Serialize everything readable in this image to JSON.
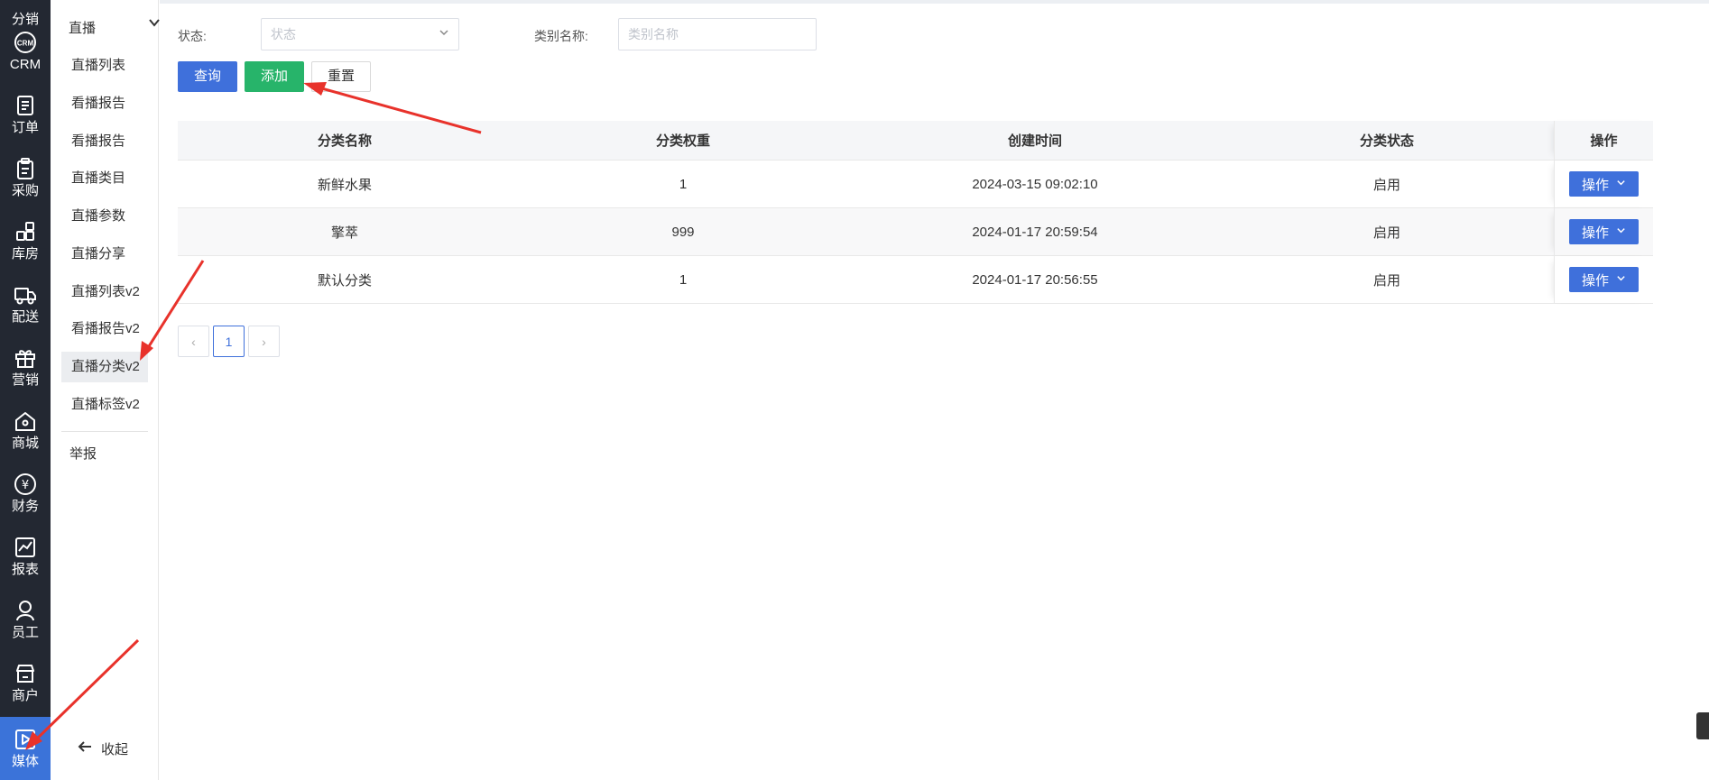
{
  "icon_nav": [
    {
      "label": "分销",
      "icon": "share-icon"
    },
    {
      "label": "CRM",
      "icon": "crm-icon"
    },
    {
      "label": "订单",
      "icon": "order-icon"
    },
    {
      "label": "采购",
      "icon": "clipboard-icon"
    },
    {
      "label": "库房",
      "icon": "warehouse-icon"
    },
    {
      "label": "配送",
      "icon": "truck-icon"
    },
    {
      "label": "营销",
      "icon": "gift-icon"
    },
    {
      "label": "商城",
      "icon": "home-icon"
    },
    {
      "label": "财务",
      "icon": "yen-icon"
    },
    {
      "label": "报表",
      "icon": "chart-icon"
    },
    {
      "label": "员工",
      "icon": "user-icon"
    },
    {
      "label": "商户",
      "icon": "shop-icon"
    },
    {
      "label": "媒体",
      "icon": "play-icon",
      "active": true
    }
  ],
  "sub_menu": {
    "group_title": "直播",
    "items": [
      "直播列表",
      "看播报告",
      "看播报告",
      "直播类目",
      "直播参数",
      "直播分享",
      "直播列表v2",
      "看播报告v2",
      "直播分类v2",
      "直播标签v2"
    ],
    "active_item": "直播分类v2",
    "other": "举报",
    "collapse_label": "收起"
  },
  "filter": {
    "status_label": "状态:",
    "status_placeholder": "状态",
    "category_label": "类别名称:",
    "category_placeholder": "类别名称"
  },
  "buttons": {
    "query": "查询",
    "add": "添加",
    "reset": "重置"
  },
  "table": {
    "headers": [
      "分类名称",
      "分类权重",
      "创建时间",
      "分类状态",
      "操作"
    ],
    "rows": [
      {
        "name": "新鲜水果",
        "weight": "1",
        "created": "2024-03-15 09:02:10",
        "status": "启用",
        "action": "操作"
      },
      {
        "name": "擎萃",
        "weight": "999",
        "created": "2024-01-17 20:59:54",
        "status": "启用",
        "action": "操作"
      },
      {
        "name": "默认分类",
        "weight": "1",
        "created": "2024-01-17 20:56:55",
        "status": "启用",
        "action": "操作"
      }
    ]
  },
  "pagination": {
    "prev": "‹",
    "current": "1",
    "next": "›"
  },
  "colors": {
    "nav_bg": "#232832",
    "nav_active": "#3b73d9",
    "primary": "#3f70db",
    "success": "#27b46a",
    "annotation": "#e8322b"
  }
}
